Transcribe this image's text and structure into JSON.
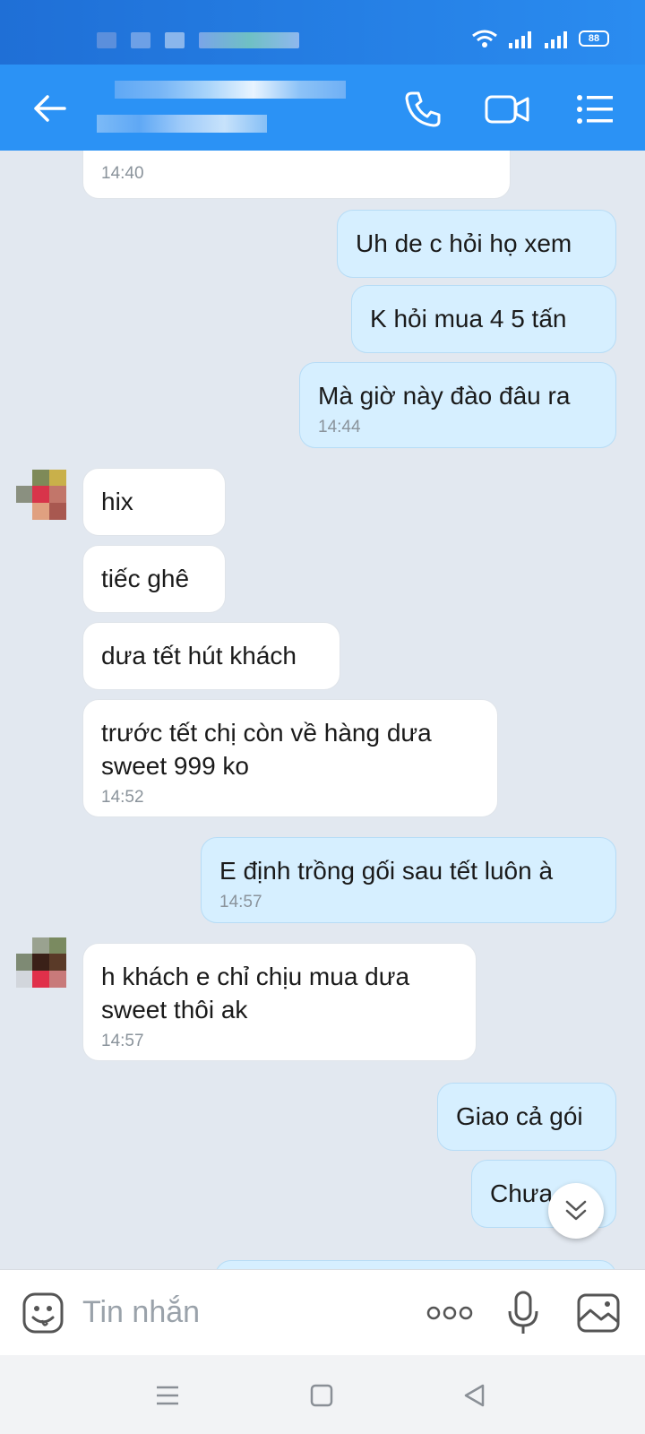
{
  "header": {
    "back_icon": "arrow-left-icon",
    "call_icon": "phone-icon",
    "video_icon": "video-camera-icon",
    "menu_icon": "list-menu-icon"
  },
  "status_bar": {
    "battery": "88"
  },
  "messages": [
    {
      "text": "",
      "time": "14:40",
      "direction": "in"
    },
    {
      "text": "Uh de c hỏi họ xem",
      "time": "",
      "direction": "out"
    },
    {
      "text": "K hỏi mua 4 5 tấn",
      "time": "",
      "direction": "out"
    },
    {
      "text": "Mà giờ này đào đâu ra",
      "time": "14:44",
      "direction": "out"
    },
    {
      "text": "hix",
      "time": "",
      "direction": "in"
    },
    {
      "text": "tiếc ghê",
      "time": "",
      "direction": "in"
    },
    {
      "text": "dưa tết hút khách",
      "time": "",
      "direction": "in"
    },
    {
      "text": "trước tết chị còn về hàng dưa sweet 999 ko",
      "time": "14:52",
      "direction": "in"
    },
    {
      "text": "E định trồng gối sau tết luôn à",
      "time": "14:57",
      "direction": "out"
    },
    {
      "text": "h khách e chỉ chịu mua dưa sweet thôi ak",
      "time": "14:57",
      "direction": "in"
    },
    {
      "text": "Giao cả gói",
      "time": "",
      "direction": "out"
    },
    {
      "text": "Chưa",
      "time": "",
      "direction": "out"
    }
  ],
  "input": {
    "placeholder": "Tin nhắn"
  },
  "colors": {
    "header": "#2b92f5",
    "bubble_out": "#d6efff",
    "bubble_in": "#ffffff",
    "background": "#e2e8f0"
  }
}
